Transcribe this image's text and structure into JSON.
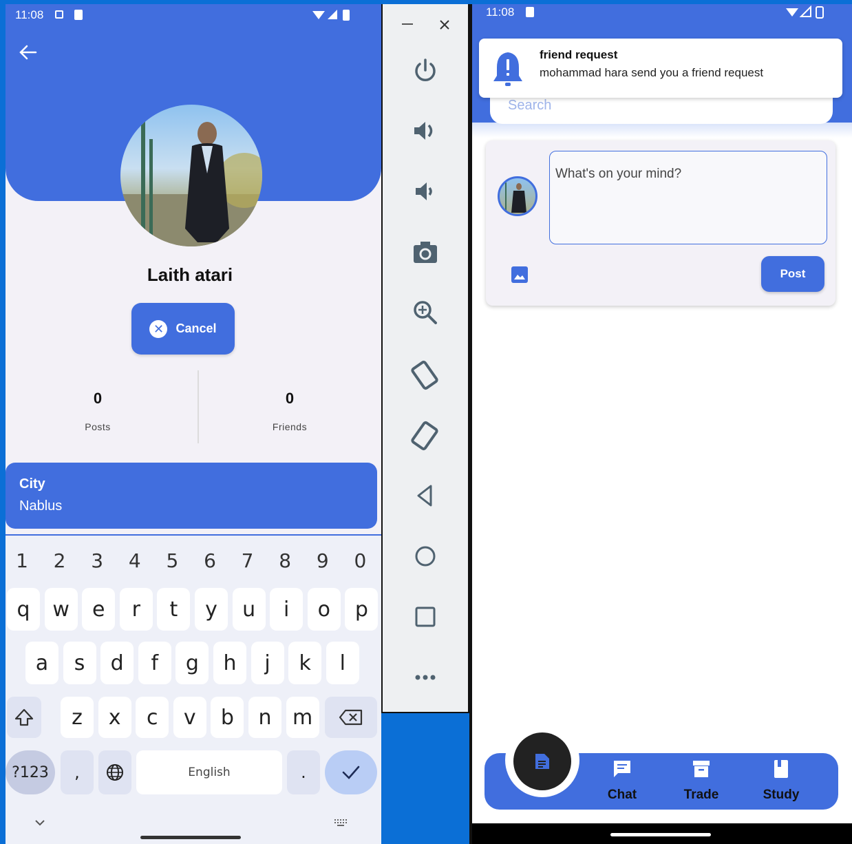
{
  "left_phone": {
    "status": {
      "time": "11:08"
    },
    "profile": {
      "name": "Laith atari",
      "cancel_label": "Cancel"
    },
    "stats": [
      {
        "value": "0",
        "label": "Posts"
      },
      {
        "value": "0",
        "label": "Friends"
      }
    ],
    "city": {
      "label": "City",
      "value": "Nablus"
    },
    "keyboard": {
      "numbers": [
        "1",
        "2",
        "3",
        "4",
        "5",
        "6",
        "7",
        "8",
        "9",
        "0"
      ],
      "row1": [
        "q",
        "w",
        "e",
        "r",
        "t",
        "y",
        "u",
        "i",
        "o",
        "p"
      ],
      "row2": [
        "a",
        "s",
        "d",
        "f",
        "g",
        "h",
        "j",
        "k",
        "l"
      ],
      "row3": [
        "z",
        "x",
        "c",
        "v",
        "b",
        "n",
        "m"
      ],
      "symbols_label": "?123",
      "comma": ",",
      "space_label": "English",
      "period": "."
    }
  },
  "emulator_toolbar": {
    "icons": [
      "minimize-icon",
      "close-icon",
      "power-icon",
      "volume-up-icon",
      "volume-down-icon",
      "camera-icon",
      "zoom-icon",
      "rotate-left-icon",
      "rotate-right-icon",
      "back-icon",
      "home-icon",
      "overview-icon",
      "more-icon"
    ]
  },
  "right_phone": {
    "status": {
      "time": "11:08"
    },
    "notification": {
      "title": "friend request",
      "body": "mohammad hara send you a friend request"
    },
    "search": {
      "placeholder": "Search"
    },
    "composer": {
      "placeholder": "What's on your mind?",
      "post_label": "Post"
    },
    "nav": [
      {
        "label": "Chat",
        "icon": "chat-icon"
      },
      {
        "label": "Trade",
        "icon": "archive-icon"
      },
      {
        "label": "Study",
        "icon": "book-icon"
      }
    ]
  },
  "colors": {
    "primary": "#416ede",
    "desktop_blue": "#0b6fd6"
  }
}
